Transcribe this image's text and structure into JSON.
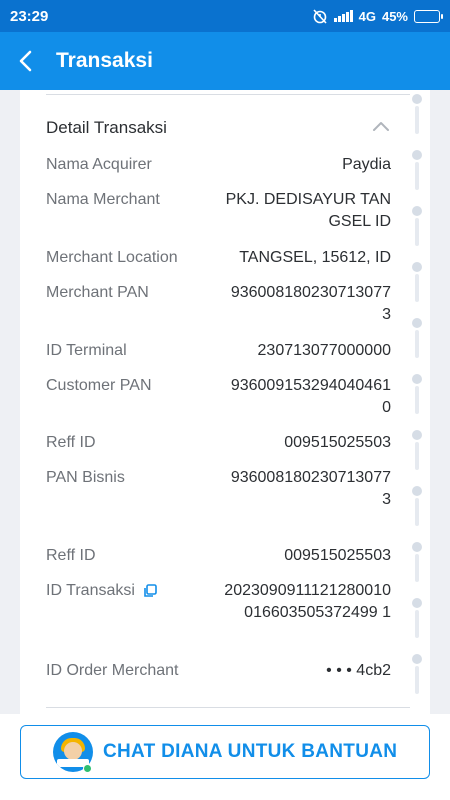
{
  "status_bar": {
    "time": "23:29",
    "network": "4G",
    "battery": "45%"
  },
  "header": {
    "title": "Transaksi"
  },
  "detail": {
    "title": "Detail Transaksi",
    "rows": [
      {
        "label": "Nama Acquirer",
        "value": "Paydia"
      },
      {
        "label": "Nama Merchant",
        "value": "PKJ. DEDISAYUR TAN GSEL ID"
      },
      {
        "label": "Merchant Location",
        "value": "TANGSEL, 15612, ID"
      },
      {
        "label": "Merchant PAN",
        "value": "9360081802307130773"
      },
      {
        "label": "ID Terminal",
        "value": "230713077000000"
      },
      {
        "label": "Customer PAN",
        "value": "9360091532940404610"
      },
      {
        "label": "Reff ID",
        "value": "009515025503"
      },
      {
        "label": "PAN Bisnis",
        "value": "9360081802307130773"
      },
      {
        "label": "Reff ID",
        "value": "009515025503"
      },
      {
        "label": "ID Transaksi",
        "value": "2023090911121280010016603505372499 1"
      },
      {
        "label": "ID Order Merchant",
        "value": "• • • 4cb2"
      }
    ]
  },
  "footer": {
    "chat_button": "CHAT DIANA UNTUK BANTUAN"
  },
  "colors": {
    "primary": "#118ee9",
    "status_bar": "#0a72cf",
    "label": "#6e7278",
    "value": "#2c2f33"
  }
}
